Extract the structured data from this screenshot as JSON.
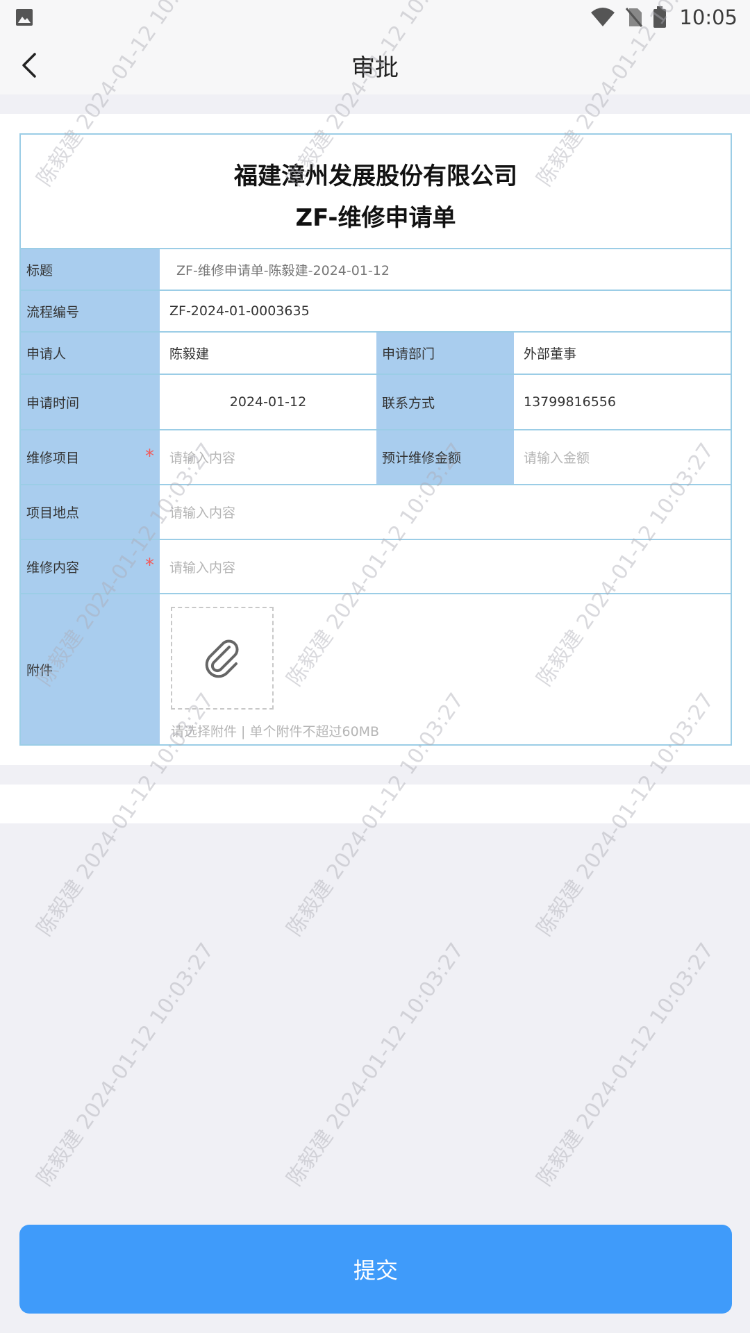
{
  "status_bar": {
    "time": "10:05"
  },
  "nav": {
    "title": "审批"
  },
  "form": {
    "company": "福建漳州发展股份有限公司",
    "form_name": "ZF-维修申请单",
    "rows": {
      "title_label": "标题",
      "title_value": "ZF-维修申请单-陈毅建-2024-01-12",
      "process_no_label": "流程编号",
      "process_no_value": "ZF-2024-01-0003635",
      "applicant_label": "申请人",
      "applicant_value": "陈毅建",
      "dept_label": "申请部门",
      "dept_value": "外部董事",
      "apply_time_label": "申请时间",
      "apply_time_value": "2024-01-12",
      "contact_label": "联系方式",
      "contact_value": "13799816556",
      "repair_item_label": "维修项目",
      "repair_item_placeholder": "请输入内容",
      "estimate_label": "预计维修金额",
      "estimate_placeholder": "请输入金额",
      "location_label": "项目地点",
      "location_placeholder": "请输入内容",
      "repair_content_label": "维修内容",
      "repair_content_placeholder": "请输入内容",
      "attachment_label": "附件",
      "attachment_tip": "请选择附件 | 单个附件不超过60MB",
      "required_mark": "*"
    }
  },
  "submit_label": "提交",
  "watermark": "陈毅建 2024-01-12 10:03:27"
}
